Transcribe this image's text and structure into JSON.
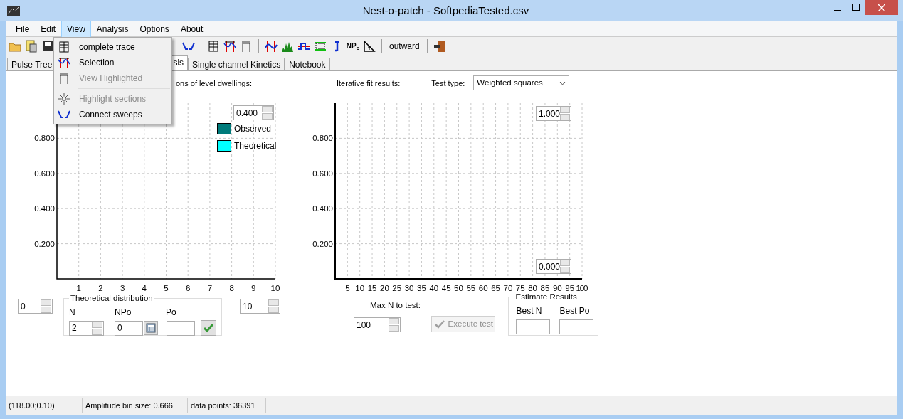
{
  "window": {
    "title": "Nest-o-patch - SoftpediaTested.csv"
  },
  "menu_bar": [
    {
      "label": "File",
      "selected": false
    },
    {
      "label": "Edit",
      "selected": false
    },
    {
      "label": "View",
      "selected": true
    },
    {
      "label": "Analysis",
      "selected": false
    },
    {
      "label": "Options",
      "selected": false
    },
    {
      "label": "About",
      "selected": false
    }
  ],
  "view_menu": [
    {
      "kind": "item",
      "label": "complete trace",
      "disabled": false
    },
    {
      "kind": "item",
      "label": "Selection",
      "disabled": false
    },
    {
      "kind": "item",
      "label": "View Highlighted",
      "disabled": true
    },
    {
      "kind": "separator"
    },
    {
      "kind": "item",
      "label": "Highlight sections",
      "disabled": true
    },
    {
      "kind": "item",
      "label": "Connect sweeps",
      "disabled": false
    }
  ],
  "toolbar": {
    "npo_button": "NP$_{o}$",
    "text_button": "outward"
  },
  "tabs": [
    {
      "label": "Pulse Tree",
      "selected": false
    },
    {
      "label": "sis",
      "selected": true
    },
    {
      "label": "Single channel Kinetics",
      "selected": false
    },
    {
      "label": "Notebook",
      "selected": false
    }
  ],
  "distribution_panel": {
    "heading": "ons of level dwellings:",
    "top_spinner": "0.400",
    "chart_data": {
      "type": "bar",
      "categories": [
        "1",
        "2",
        "3",
        "4",
        "5",
        "6",
        "7",
        "8",
        "9",
        "10"
      ],
      "series": [
        {
          "name": "Observed",
          "color": "#007b7b",
          "values": [
            null,
            null,
            null,
            null,
            null,
            null,
            null,
            null,
            null,
            null
          ]
        },
        {
          "name": "Theoretical",
          "color": "#00ffff",
          "values": [
            null,
            null,
            null,
            null,
            null,
            null,
            null,
            null,
            null,
            null
          ]
        }
      ],
      "yticks": [
        {
          "value": 0.2,
          "label": "0.200"
        },
        {
          "value": 0.4,
          "label": "0.400"
        },
        {
          "value": 0.6,
          "label": "0.600"
        },
        {
          "value": 0.8,
          "label": "0.800"
        }
      ],
      "ylim": [
        0,
        1
      ],
      "grid": true
    },
    "min_spinner": "0",
    "max_spinner": "10",
    "theoretical_distribution": {
      "title": "Theoretical distribution",
      "n_label": "N",
      "n_value": "2",
      "npo_label": "NPo",
      "npo_value": "0",
      "po_label": "Po"
    }
  },
  "fit_panel": {
    "heading": "Iterative fit results:",
    "test_type_label": "Test type:",
    "test_type": "Weighted squares",
    "top_spinner": "1.000",
    "bottom_spinner": "0.000",
    "chart_data": {
      "type": "line",
      "xticks": [
        5,
        10,
        15,
        20,
        25,
        30,
        35,
        40,
        45,
        50,
        55,
        60,
        65,
        70,
        75,
        80,
        85,
        90,
        95,
        100
      ],
      "yticks": [
        {
          "value": 0.2,
          "label": "0.200"
        },
        {
          "value": 0.4,
          "label": "0.400"
        },
        {
          "value": 0.6,
          "label": "0.600"
        },
        {
          "value": 0.8,
          "label": "0.800"
        }
      ],
      "xlim": [
        0,
        100
      ],
      "ylim": [
        0,
        1
      ],
      "grid": true
    },
    "max_n_label": "Max N to test:",
    "max_n_value": "100",
    "execute_button": {
      "label": "Execute test",
      "disabled": true
    },
    "estimate_results": {
      "title": "Estimate Results",
      "best_n_label": "Best N",
      "best_po_label": "Best Po"
    }
  },
  "status_bar": [
    "(118.00;0.10)",
    "Amplitude bin size: 0.666",
    "data points: 36391"
  ]
}
